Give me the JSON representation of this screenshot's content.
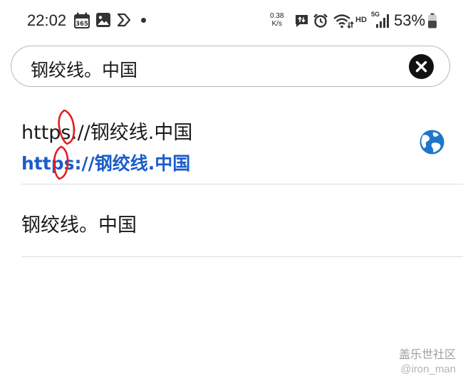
{
  "status_bar": {
    "time": "22:02",
    "calendar_badge": "365",
    "net_speed_value": "0.38",
    "net_speed_unit": "K/s",
    "network_type": "HD",
    "signal_gen": "5G",
    "battery_percent": "53%"
  },
  "search": {
    "query": "钢绞线。中国"
  },
  "suggestions": [
    {
      "title": "https://钢绞线.中国",
      "url": "https://钢绞线.中国"
    },
    {
      "title": "钢绞线。中国"
    }
  ],
  "watermark": {
    "line1": "盖乐世社区",
    "line2": "@iron_man"
  },
  "colors": {
    "url_blue": "#1a5cc9",
    "globe_blue": "#1e76c9",
    "annotation_red": "#e02020"
  }
}
